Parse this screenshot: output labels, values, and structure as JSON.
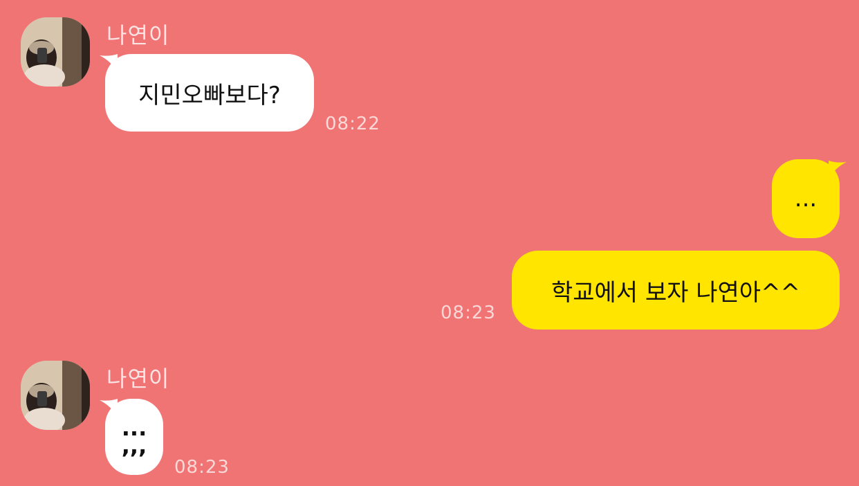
{
  "conversation": {
    "messages": [
      {
        "sender": "나연이",
        "direction": "incoming",
        "text": "지민오빠보다?",
        "time": "08:22"
      },
      {
        "direction": "outgoing",
        "text": "...",
        "time": ""
      },
      {
        "direction": "outgoing",
        "text": "학교에서 보자 나연아^^",
        "time": "08:23"
      },
      {
        "sender": "나연이",
        "direction": "incoming",
        "text_line1": "...",
        "text_line2": ",,,",
        "time": "08:23"
      }
    ]
  },
  "colors": {
    "background": "#f07474",
    "incoming_bubble": "#ffffff",
    "outgoing_bubble": "#ffe500",
    "timestamp": "#fbd8d8",
    "sender_name": "#fbe3e3"
  },
  "icons": {
    "avatar": "profile-photo-avatar-icon"
  }
}
